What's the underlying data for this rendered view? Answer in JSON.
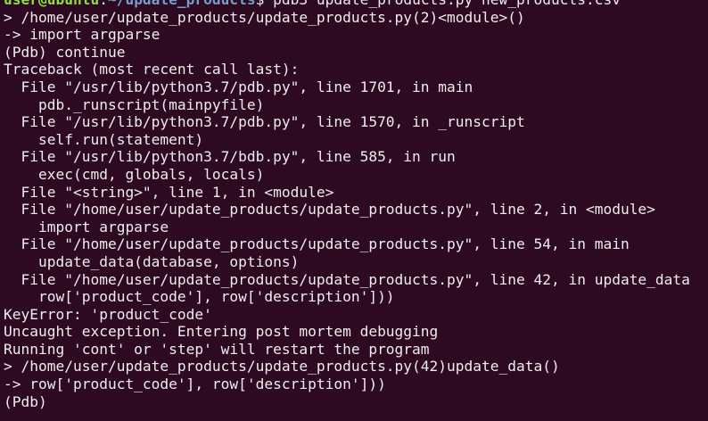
{
  "window": {
    "background": "#300a24",
    "text_color": "#eeeeec",
    "prompt_user_color": "#8ae234",
    "prompt_path_color": "#729fcf"
  },
  "prompt": {
    "user_host": "user@ubuntu",
    "separator": ":",
    "path": "~/update_products",
    "symbol": "$",
    "command": " pdb3 update_products.py new_products.csv"
  },
  "lines": [
    "> /home/user/update_products/update_products.py(2)<module>()",
    "-> import argparse",
    "(Pdb) continue",
    "Traceback (most recent call last):",
    "  File \"/usr/lib/python3.7/pdb.py\", line 1701, in main",
    "    pdb._runscript(mainpyfile)",
    "  File \"/usr/lib/python3.7/pdb.py\", line 1570, in _runscript",
    "    self.run(statement)",
    "  File \"/usr/lib/python3.7/bdb.py\", line 585, in run",
    "    exec(cmd, globals, locals)",
    "  File \"<string>\", line 1, in <module>",
    "  File \"/home/user/update_products/update_products.py\", line 2, in <module>",
    "    import argparse",
    "  File \"/home/user/update_products/update_products.py\", line 54, in main",
    "    update_data(database, options)",
    "  File \"/home/user/update_products/update_products.py\", line 42, in update_data",
    "    row['product_code'], row['description']))",
    "KeyError: 'product_code'",
    "Uncaught exception. Entering post mortem debugging",
    "Running 'cont' or 'step' will restart the program",
    "> /home/user/update_products/update_products.py(42)update_data()",
    "-> row['product_code'], row['description']))",
    "(Pdb)"
  ]
}
